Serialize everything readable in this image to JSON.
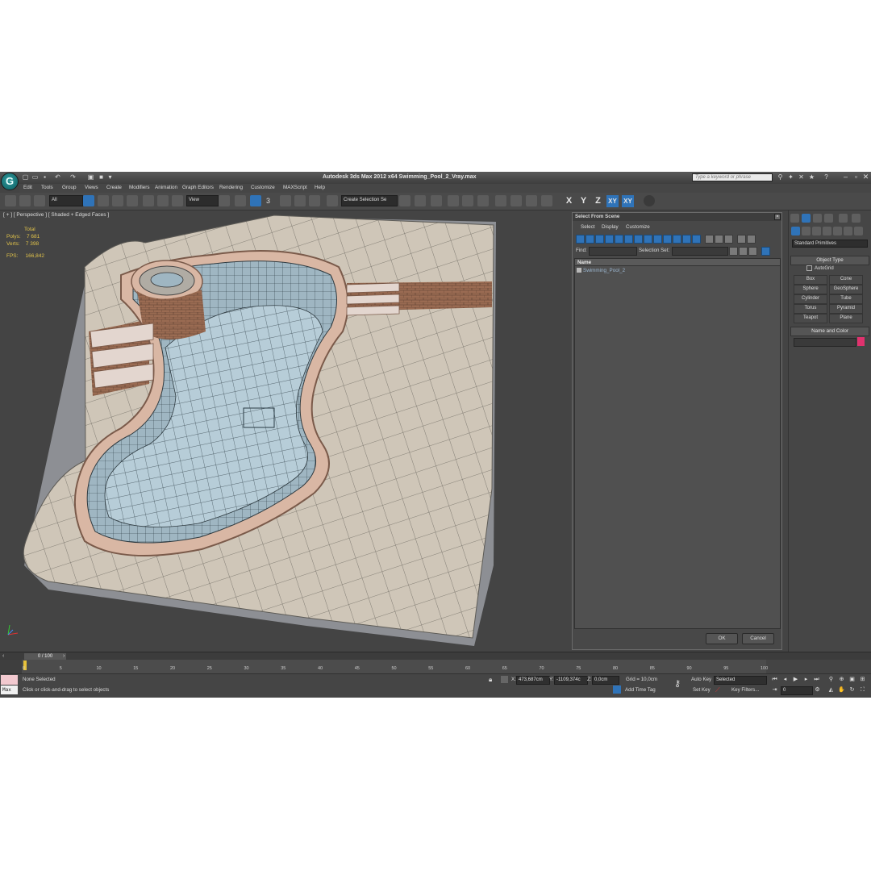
{
  "window": {
    "title": "Autodesk 3ds Max  2012 x64      Swimming_Pool_2_Vray.max",
    "search_placeholder": "Type a keyword or phrase",
    "logo_letter": "G"
  },
  "menu": [
    "Edit",
    "Tools",
    "Group",
    "Views",
    "Create",
    "Modifiers",
    "Animation",
    "Graph Editors",
    "Rendering",
    "Customize",
    "MAXScript",
    "Help"
  ],
  "toolbar": {
    "filter": "All",
    "reference_coord": "View",
    "selection_set": "Create Selection Se",
    "snap_label": "3",
    "axes": [
      "X",
      "Y",
      "Z",
      "XY",
      "XY"
    ]
  },
  "viewport": {
    "label": "[ + ] [ Perspective ] [ Shaded + Edged Faces ]",
    "stats": {
      "total_label": "Total",
      "polys_label": "Polys:",
      "polys": "7 681",
      "verts_label": "Verts:",
      "verts": "7 398",
      "fps_label": "FPS:",
      "fps": "166,842"
    }
  },
  "dialog": {
    "title": "Select From Scene",
    "menu": [
      "Select",
      "Display",
      "Customize"
    ],
    "find_label": "Find:",
    "selection_set_label": "Selection Set:",
    "column_name": "Name",
    "rows": [
      "Swimming_Pool_2"
    ],
    "ok": "OK",
    "cancel": "Cancel"
  },
  "command_panel": {
    "category": "Standard Primitives",
    "object_type": "Object Type",
    "autogrid": "AutoGrid",
    "primitives": [
      "Box",
      "Cone",
      "Sphere",
      "GeoSphere",
      "Cylinder",
      "Tube",
      "Torus",
      "Pyramid",
      "Teapot",
      "Plane"
    ],
    "name_and_color": "Name and Color",
    "color_swatch": "#e0326e"
  },
  "timeline": {
    "frame_counter": "0 / 100",
    "ticks": [
      "0",
      "5",
      "10",
      "15",
      "20",
      "25",
      "30",
      "35",
      "40",
      "45",
      "50",
      "55",
      "60",
      "65",
      "70",
      "75",
      "80",
      "85",
      "90",
      "95",
      "100"
    ]
  },
  "status": {
    "maxscript_label": "Max",
    "selection": "None Selected",
    "prompt": "Click or click-and-drag to select objects",
    "x_label": "X:",
    "x": "473,687cm",
    "y_label": "Y:",
    "y": "-1109,374c",
    "z_label": "Z:",
    "z": "0,0cm",
    "grid": "Grid = 10,0cm",
    "add_time_tag": "Add Time Tag",
    "auto_key": "Auto Key",
    "set_key": "Set Key",
    "key_mode": "Selected",
    "key_filters": "Key Filters...",
    "current_frame": "0"
  }
}
